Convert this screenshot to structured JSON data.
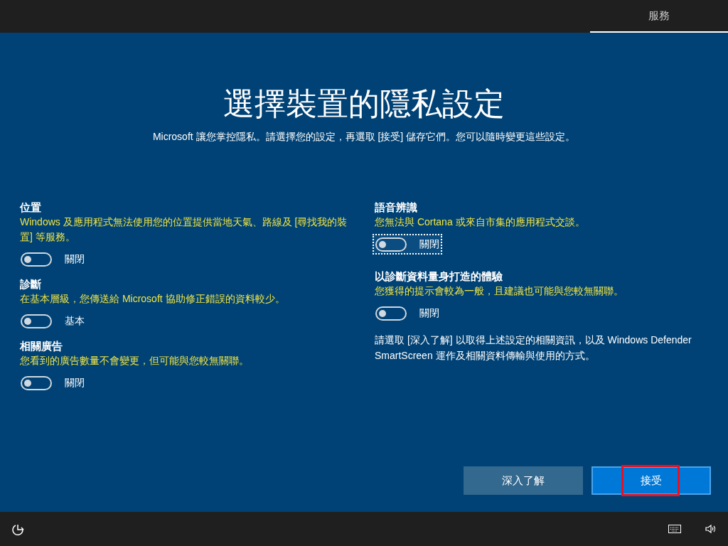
{
  "header": {
    "tabs": [
      {
        "label": "服務",
        "selected": true
      }
    ]
  },
  "title": "選擇裝置的隱私設定",
  "subtitle": "Microsoft 讓您掌控隱私。請選擇您的設定，再選取 [接受] 儲存它們。您可以隨時變更這些設定。",
  "left_settings": [
    {
      "title": "位置",
      "description": "Windows 及應用程式無法使用您的位置提供當地天氣、路線及 [尋找我的裝置] 等服務。",
      "on": false,
      "state_label": "關閉",
      "focused": false
    },
    {
      "title": "診斷",
      "description": "在基本層級，您傳送給 Microsoft 協助修正錯誤的資料較少。",
      "on": false,
      "state_label": "基本",
      "focused": false
    },
    {
      "title": "相關廣告",
      "description": "您看到的廣告數量不會變更，但可能與您較無關聯。",
      "on": false,
      "state_label": "關閉",
      "focused": false
    }
  ],
  "right_settings": [
    {
      "title": "語音辨識",
      "description": "您無法與 Cortana 或來自市集的應用程式交談。",
      "on": false,
      "state_label": "關閉",
      "focused": true
    },
    {
      "title": "以診斷資料量身打造的體驗",
      "description": "您獲得的提示會較為一般，且建議也可能與您較無關聯。",
      "on": false,
      "state_label": "關閉",
      "focused": false
    }
  ],
  "info_text": "請選取 [深入了解] 以取得上述設定的相關資訊，以及 Windows Defender SmartScreen 運作及相關資料傳輸與使用的方式。",
  "buttons": [
    {
      "label": "深入了解",
      "kind": "secondary",
      "highlighted": false
    },
    {
      "label": "接受",
      "kind": "primary",
      "highlighted": true
    }
  ]
}
